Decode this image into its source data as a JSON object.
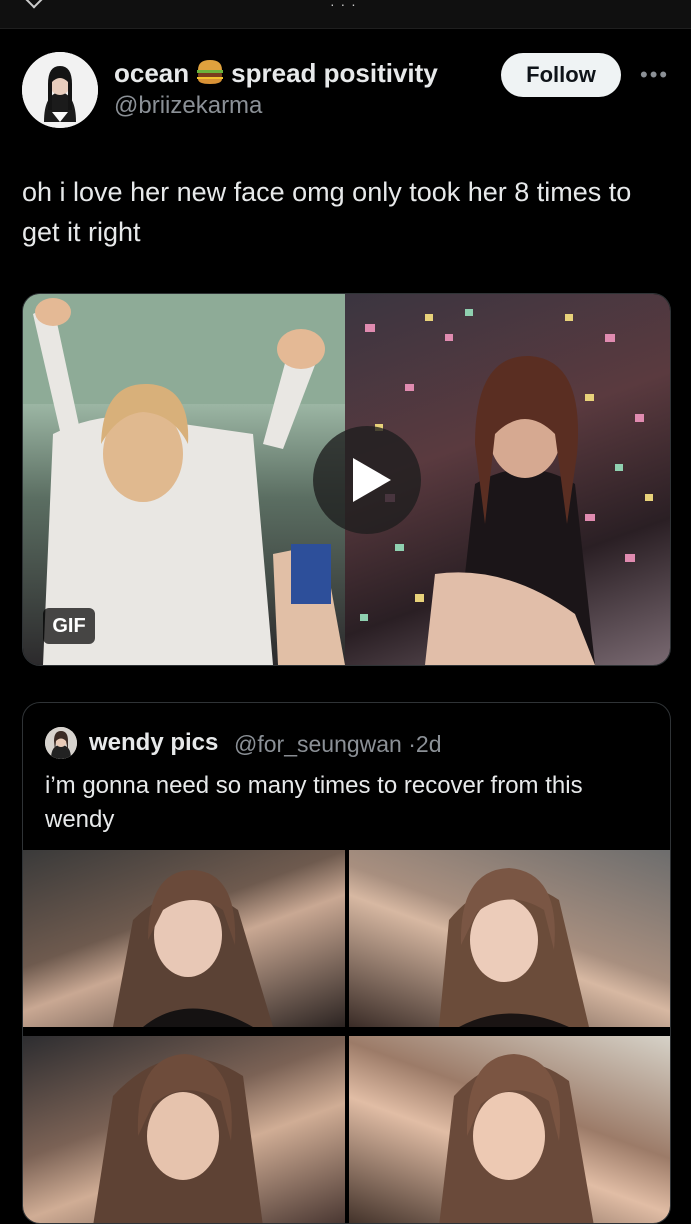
{
  "tweet": {
    "author_name_part1": "ocean",
    "author_name_part2": "spread positivity",
    "author_handle": "@briizekarma",
    "follow_label": "Follow",
    "text": "oh i love her new face omg only took her 8 times to get it right",
    "media": {
      "badge_label": "GIF"
    }
  },
  "quote": {
    "author_name": "wendy pics",
    "author_handle": "@for_seungwan",
    "separator": "·",
    "timestamp": "2d",
    "text": "i’m gonna need so many times to recover from this wendy"
  },
  "icons": {
    "author_emoji": "hamburger-icon",
    "more": "more-options-icon",
    "play": "play-icon"
  }
}
